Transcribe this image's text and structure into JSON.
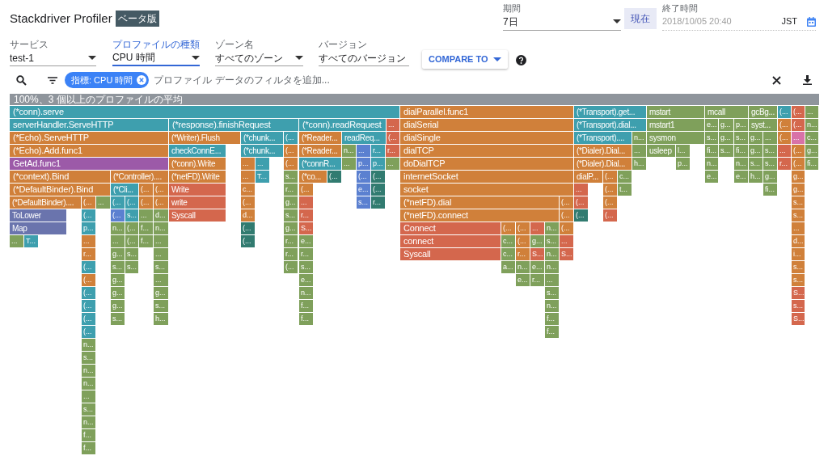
{
  "title": "Stackdriver Profiler",
  "badge": "ベータ版",
  "period": {
    "label": "期間",
    "value": "7日"
  },
  "now_button": "現在",
  "end_time": {
    "label": "終了時間",
    "value": "2018/10/05 20:40",
    "timezone": "JST"
  },
  "selects": [
    {
      "label": "サービス",
      "value": "test-1",
      "focused": false
    },
    {
      "label": "プロファイルの種類",
      "value": "CPU 時間",
      "focused": true
    },
    {
      "label": "ゾーン名",
      "value": "すべてのゾーン",
      "focused": false
    },
    {
      "label": "バージョン",
      "value": "すべてのバージョン",
      "focused": false
    }
  ],
  "compare_button": "COMPARE TO",
  "filter": {
    "chips": [
      {
        "label": "指標: CPU 時間"
      }
    ],
    "placeholder": "プロファイル データのフィルタを追加..."
  },
  "flame_graph": {
    "header": "100%、3 個以上のプロファイルの平均",
    "frames": [
      {
        "label": "(*conn).serve",
        "color": "#3e9fae"
      },
      {
        "label": "dialParallel.func1",
        "color": "#d0803a"
      },
      {
        "label": "(*Transport).get...",
        "color": "#3e9fae"
      },
      {
        "label": "mstart",
        "color": "#7fa05b"
      },
      {
        "label": "mcall",
        "color": "#7fa05b"
      },
      {
        "label": "gcBg...",
        "color": "#7fa05b"
      },
      {
        "label": "(...",
        "color": "#3e9fae"
      },
      {
        "label": "(...",
        "color": "#d4674d"
      },
      {
        "label": "...",
        "color": "#7fa05b"
      },
      {
        "label": "serverHandler.ServeHTTP",
        "color": "#3e9fae"
      },
      {
        "label": "(*response).finishRequest",
        "color": "#3e9fae"
      },
      {
        "label": "(*conn).readRequest",
        "color": "#3e9fae"
      },
      {
        "label": "...",
        "color": "#d4674d"
      },
      {
        "label": "dialSerial",
        "color": "#d0803a"
      },
      {
        "label": "(*Transport).dial...",
        "color": "#3e9fae"
      },
      {
        "label": "mstart1",
        "color": "#7fa05b"
      },
      {
        "label": "e...",
        "color": "#7fa05b"
      },
      {
        "label": "g...",
        "color": "#7fa05b"
      },
      {
        "label": "p...",
        "color": "#7fa05b"
      },
      {
        "label": "syst...",
        "color": "#7fa05b"
      },
      {
        "label": "(...",
        "color": "#d0803a"
      },
      {
        "label": "(...",
        "color": "#d4674d"
      },
      {
        "label": "n...",
        "color": "#7fa05b"
      },
      {
        "label": "(*Echo).ServeHTTP",
        "color": "#d0803a"
      },
      {
        "label": "(*Writer).Flush",
        "color": "#d0803a"
      },
      {
        "label": "(*chunk...",
        "color": "#3e9fae"
      },
      {
        "label": "(...",
        "color": "#3e9fae"
      },
      {
        "label": "(*Reader...",
        "color": "#d0803a"
      },
      {
        "label": "readReq...",
        "color": "#3e9fae"
      },
      {
        "label": "(...",
        "color": "#d4674d"
      },
      {
        "label": "dialSingle",
        "color": "#d0803a"
      },
      {
        "label": "(*Transport)....",
        "color": "#3e9fae"
      },
      {
        "label": "n...",
        "color": "#7fa05b"
      },
      {
        "label": "sysmon",
        "color": "#7fa05b"
      },
      {
        "label": "s...",
        "color": "#7fa05b"
      },
      {
        "label": "g...",
        "color": "#7fa05b"
      },
      {
        "label": "s...",
        "color": "#7fa05b"
      },
      {
        "label": "g...",
        "color": "#7fa05b"
      },
      {
        "label": "...",
        "color": "#7fa05b"
      },
      {
        "label": "(...",
        "color": "#d0803a"
      },
      {
        "label": "...",
        "color": "#d872a8"
      },
      {
        "label": "c...",
        "color": "#7fa05b"
      },
      {
        "label": "(*Echo).Add.func1",
        "color": "#d0803a"
      },
      {
        "label": "checkConnE...",
        "color": "#3e9fae"
      },
      {
        "label": "(*chunk...",
        "color": "#3e9fae"
      },
      {
        "label": "(...",
        "color": "#d0803a"
      },
      {
        "label": "(*Reader...",
        "color": "#d0803a"
      },
      {
        "label": "n...",
        "color": "#7fa05b"
      },
      {
        "label": "...",
        "color": "#5b80d0"
      },
      {
        "label": "r...",
        "color": "#3e9fae"
      },
      {
        "label": "r...",
        "color": "#d4674d"
      },
      {
        "label": "dialTCP",
        "color": "#d0803a"
      },
      {
        "label": "(*Dialer).Dial...",
        "color": "#d0803a"
      },
      {
        "label": "...",
        "color": "#7fa05b"
      },
      {
        "label": "usleep",
        "color": "#7fa05b"
      },
      {
        "label": "l...",
        "color": "#7fa05b"
      },
      {
        "label": "fi...",
        "color": "#7fa05b"
      },
      {
        "label": "s...",
        "color": "#7fa05b"
      },
      {
        "label": "fi...",
        "color": "#7fa05b"
      },
      {
        "label": "g...",
        "color": "#7fa05b"
      },
      {
        "label": "s...",
        "color": "#7fa05b"
      },
      {
        "label": "...",
        "color": "#d4674d"
      },
      {
        "label": "(...",
        "color": "#d0803a"
      },
      {
        "label": "g...",
        "color": "#7fa05b"
      },
      {
        "label": "GetAd.func1",
        "color": "#9c5aa8"
      },
      {
        "label": "(*conn).Write",
        "color": "#d0803a"
      },
      {
        "label": "...",
        "color": "#d0803a"
      },
      {
        "label": "...",
        "color": "#3e9fae"
      },
      {
        "label": "(...",
        "color": "#d0803a"
      },
      {
        "label": "(*connR...",
        "color": "#3e9fae"
      },
      {
        "label": "...",
        "color": "#7fa05b"
      },
      {
        "label": "p...",
        "color": "#5b80d0"
      },
      {
        "label": "p...",
        "color": "#3e9fae"
      },
      {
        "label": "...",
        "color": "#7fa05b"
      },
      {
        "label": "doDialTCP",
        "color": "#d0803a"
      },
      {
        "label": "(*Dialer).Dial...",
        "color": "#d0803a"
      },
      {
        "label": "h...",
        "color": "#7fa05b"
      },
      {
        "label": "p...",
        "color": "#7fa05b"
      },
      {
        "label": "n...",
        "color": "#7fa05b"
      },
      {
        "label": "n...",
        "color": "#7fa05b"
      },
      {
        "label": "s...",
        "color": "#7fa05b"
      },
      {
        "label": "s...",
        "color": "#7fa05b"
      },
      {
        "label": "r...",
        "color": "#d4674d"
      },
      {
        "label": "(...",
        "color": "#d0803a"
      },
      {
        "label": "fi...",
        "color": "#7fa05b"
      },
      {
        "label": "(*context).Bind",
        "color": "#d0803a"
      },
      {
        "label": "(*Controller)....",
        "color": "#d0803a"
      },
      {
        "label": "(*netFD).Write",
        "color": "#d0803a"
      },
      {
        "label": "...",
        "color": "#d0803a"
      },
      {
        "label": "T...",
        "color": "#3e9fae"
      },
      {
        "label": "s...",
        "color": "#7fa05b"
      },
      {
        "label": "(*co...",
        "color": "#d0803a"
      },
      {
        "label": "(...",
        "color": "#317b70"
      },
      {
        "label": "(...",
        "color": "#5b80d0"
      },
      {
        "label": "(...",
        "color": "#317b70"
      },
      {
        "label": "internetSocket",
        "color": "#d0803a"
      },
      {
        "label": "dialP...",
        "color": "#d0803a"
      },
      {
        "label": "(...",
        "color": "#d0803a"
      },
      {
        "label": "c...",
        "color": "#7fa05b"
      },
      {
        "label": "e...",
        "color": "#7fa05b"
      },
      {
        "label": "e...",
        "color": "#7fa05b"
      },
      {
        "label": "h...",
        "color": "#7fa05b"
      },
      {
        "label": "g...",
        "color": "#7fa05b"
      },
      {
        "label": "g...",
        "color": "#d0803a"
      },
      {
        "label": "(*DefaultBinder).Bind",
        "color": "#d0803a"
      },
      {
        "label": "(*Cli...",
        "color": "#3e9fae"
      },
      {
        "label": "(...",
        "color": "#d0803a"
      },
      {
        "label": "(...",
        "color": "#d0803a"
      },
      {
        "label": "Write",
        "color": "#d4674d"
      },
      {
        "label": "c...",
        "color": "#d0803a"
      },
      {
        "label": "r...",
        "color": "#7fa05b"
      },
      {
        "label": "(...",
        "color": "#d0803a"
      },
      {
        "label": "e...",
        "color": "#5b80d0"
      },
      {
        "label": "(...",
        "color": "#317b70"
      },
      {
        "label": "socket",
        "color": "#d0803a"
      },
      {
        "label": "...",
        "color": "#d4674d"
      },
      {
        "label": "(...",
        "color": "#d0803a"
      },
      {
        "label": "t...",
        "color": "#7fa05b"
      },
      {
        "label": "fi...",
        "color": "#7fa05b"
      },
      {
        "label": "g...",
        "color": "#d0803a"
      },
      {
        "label": "(*DefaultBinder)....",
        "color": "#d0803a"
      },
      {
        "label": "(...",
        "color": "#d0803a"
      },
      {
        "label": "...",
        "color": "#7fa05b"
      },
      {
        "label": "(...",
        "color": "#3e9fae"
      },
      {
        "label": "(...",
        "color": "#3e9fae"
      },
      {
        "label": "(...",
        "color": "#d0803a"
      },
      {
        "label": "(...",
        "color": "#d0803a"
      },
      {
        "label": "write",
        "color": "#d4674d"
      },
      {
        "label": "(...",
        "color": "#d0803a"
      },
      {
        "label": "g...",
        "color": "#7fa05b"
      },
      {
        "label": "...",
        "color": "#d4674d"
      },
      {
        "label": "s...",
        "color": "#5b80d0"
      },
      {
        "label": "r...",
        "color": "#317b70"
      },
      {
        "label": "(*netFD).dial",
        "color": "#d0803a"
      },
      {
        "label": "(...",
        "color": "#d0803a"
      },
      {
        "label": "(...",
        "color": "#d4674d"
      },
      {
        "label": "(...",
        "color": "#d0803a"
      },
      {
        "label": "s...",
        "color": "#d0803a"
      },
      {
        "label": "ToLower",
        "color": "#6a74ad"
      },
      {
        "label": "(...",
        "color": "#3e9fae"
      },
      {
        "label": "(...",
        "color": "#5b80d0"
      },
      {
        "label": "s...",
        "color": "#3e9fae"
      },
      {
        "label": "...",
        "color": "#7fa05b"
      },
      {
        "label": "d...",
        "color": "#7fa05b"
      },
      {
        "label": "Syscall",
        "color": "#d4674d"
      },
      {
        "label": "d...",
        "color": "#d0803a"
      },
      {
        "label": "s...",
        "color": "#7fa05b"
      },
      {
        "label": "r...",
        "color": "#d4674d"
      },
      {
        "label": "(*netFD).connect",
        "color": "#d0803a"
      },
      {
        "label": "(...",
        "color": "#d0803a"
      },
      {
        "label": "(...",
        "color": "#317b70"
      },
      {
        "label": "(...",
        "color": "#d4674d"
      },
      {
        "label": "s...",
        "color": "#d0803a"
      },
      {
        "label": "Map",
        "color": "#6a74ad"
      },
      {
        "label": "p...",
        "color": "#3e9fae"
      },
      {
        "label": "n...",
        "color": "#7fa05b"
      },
      {
        "label": "(...",
        "color": "#7fa05b"
      },
      {
        "label": "f...",
        "color": "#7fa05b"
      },
      {
        "label": "n...",
        "color": "#7fa05b"
      },
      {
        "label": "(...",
        "color": "#317b70"
      },
      {
        "label": "g...",
        "color": "#7fa05b"
      },
      {
        "label": "S...",
        "color": "#d4674d"
      },
      {
        "label": "Connect",
        "color": "#d4674d"
      },
      {
        "label": "(...",
        "color": "#d0803a"
      },
      {
        "label": "(...",
        "color": "#d0803a"
      },
      {
        "label": "...",
        "color": "#d4674d"
      },
      {
        "label": "n...",
        "color": "#7fa05b"
      },
      {
        "label": "(...",
        "color": "#d0803a"
      },
      {
        "label": "...",
        "color": "#d0803a"
      },
      {
        "label": "...",
        "color": "#7fa05b"
      },
      {
        "label": "T...",
        "color": "#3e9fae"
      },
      {
        "label": "...",
        "color": "#d0803a"
      },
      {
        "label": "...",
        "color": "#7fa05b"
      },
      {
        "label": "(...",
        "color": "#7fa05b"
      },
      {
        "label": "f...",
        "color": "#7fa05b"
      },
      {
        "label": "...",
        "color": "#7fa05b"
      },
      {
        "label": "(...",
        "color": "#317b70"
      },
      {
        "label": "r...",
        "color": "#7fa05b"
      },
      {
        "label": "e...",
        "color": "#7fa05b"
      },
      {
        "label": "connect",
        "color": "#d4674d"
      },
      {
        "label": "c...",
        "color": "#7fa05b"
      },
      {
        "label": "(...",
        "color": "#d0803a"
      },
      {
        "label": "g...",
        "color": "#7fa05b"
      },
      {
        "label": "s...",
        "color": "#7fa05b"
      },
      {
        "label": "...",
        "color": "#d4674d"
      },
      {
        "label": "d...",
        "color": "#d0803a"
      },
      {
        "label": "r...",
        "color": "#d0803a"
      },
      {
        "label": "g...",
        "color": "#7fa05b"
      },
      {
        "label": "s...",
        "color": "#7fa05b"
      },
      {
        "label": "...",
        "color": "#7fa05b"
      },
      {
        "label": "r...",
        "color": "#7fa05b"
      },
      {
        "label": "r...",
        "color": "#7fa05b"
      },
      {
        "label": "Syscall",
        "color": "#d4674d"
      },
      {
        "label": "c...",
        "color": "#7fa05b"
      },
      {
        "label": "r...",
        "color": "#d0803a"
      },
      {
        "label": "S...",
        "color": "#d4674d"
      },
      {
        "label": "n...",
        "color": "#7fa05b"
      },
      {
        "label": "S...",
        "color": "#d4674d"
      },
      {
        "label": "i...",
        "color": "#d0803a"
      },
      {
        "label": "(...",
        "color": "#3e9fae"
      },
      {
        "label": "s...",
        "color": "#7fa05b"
      },
      {
        "label": "s...",
        "color": "#7fa05b"
      },
      {
        "label": "s...",
        "color": "#7fa05b"
      },
      {
        "label": "(...",
        "color": "#7fa05b"
      },
      {
        "label": "s...",
        "color": "#7fa05b"
      },
      {
        "label": "a...",
        "color": "#7fa05b"
      },
      {
        "label": "n...",
        "color": "#7fa05b"
      },
      {
        "label": "e...",
        "color": "#7fa05b"
      },
      {
        "label": "n...",
        "color": "#7fa05b"
      },
      {
        "label": "s...",
        "color": "#d0803a"
      },
      {
        "label": "(...",
        "color": "#d0803a"
      },
      {
        "label": "g...",
        "color": "#7fa05b"
      },
      {
        "label": "...",
        "color": "#7fa05b"
      },
      {
        "label": "e...",
        "color": "#7fa05b"
      },
      {
        "label": "e...",
        "color": "#7fa05b"
      },
      {
        "label": "r...",
        "color": "#7fa05b"
      },
      {
        "label": "...",
        "color": "#7fa05b"
      },
      {
        "label": "s...",
        "color": "#d0803a"
      },
      {
        "label": "(...",
        "color": "#3e9fae"
      },
      {
        "label": "g...",
        "color": "#7fa05b"
      },
      {
        "label": "g...",
        "color": "#7fa05b"
      },
      {
        "label": "n...",
        "color": "#7fa05b"
      },
      {
        "label": "s...",
        "color": "#7fa05b"
      },
      {
        "label": "S...",
        "color": "#d4674d"
      },
      {
        "label": "(...",
        "color": "#3e9fae"
      },
      {
        "label": "g...",
        "color": "#7fa05b"
      },
      {
        "label": "s...",
        "color": "#7fa05b"
      },
      {
        "label": "f...",
        "color": "#7fa05b"
      },
      {
        "label": "n...",
        "color": "#7fa05b"
      },
      {
        "label": "s...",
        "color": "#d4674d"
      },
      {
        "label": "(...",
        "color": "#3e9fae"
      },
      {
        "label": "s...",
        "color": "#7fa05b"
      },
      {
        "label": "h...",
        "color": "#7fa05b"
      },
      {
        "label": "f...",
        "color": "#7fa05b"
      },
      {
        "label": "f...",
        "color": "#7fa05b"
      },
      {
        "label": "S...",
        "color": "#d4674d"
      },
      {
        "label": "(...",
        "color": "#3e9fae"
      },
      {
        "label": "f...",
        "color": "#7fa05b"
      },
      {
        "label": "n...",
        "color": "#7fa05b"
      },
      {
        "label": "s...",
        "color": "#7fa05b"
      },
      {
        "label": "n...",
        "color": "#7fa05b"
      },
      {
        "label": "n...",
        "color": "#7fa05b"
      },
      {
        "label": "...",
        "color": "#7fa05b"
      },
      {
        "label": "s...",
        "color": "#7fa05b"
      },
      {
        "label": "n...",
        "color": "#7fa05b"
      },
      {
        "label": "f...",
        "color": "#7fa05b"
      },
      {
        "label": "f...",
        "color": "#7fa05b"
      }
    ]
  }
}
